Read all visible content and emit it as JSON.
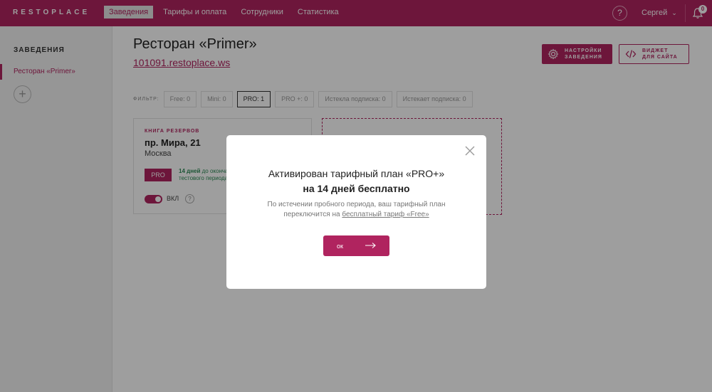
{
  "app": {
    "logo": "RESTOPLACE"
  },
  "topnav": {
    "items": [
      {
        "label": "Заведения",
        "active": true
      },
      {
        "label": "Тарифы и оплата",
        "active": false
      },
      {
        "label": "Сотрудники",
        "active": false
      },
      {
        "label": "Статистика",
        "active": false
      }
    ],
    "help": "?",
    "user": "Сергей",
    "notifications_count": "0"
  },
  "sidebar": {
    "title": "ЗАВЕДЕНИЯ",
    "items": [
      {
        "label": "Ресторан «Primer»"
      }
    ],
    "add": "+"
  },
  "main": {
    "title": "Ресторан «Primer»",
    "link": "101091.restoplace.ws",
    "settings_btn": [
      "НАСТРОЙКИ",
      "ЗАВЕДЕНИЯ"
    ],
    "widget_btn": [
      "ВИДЖЕТ",
      "ДЛЯ САЙТА"
    ],
    "filter_label": "ФИЛЬТР:",
    "filters": [
      {
        "label": "Free: 0",
        "active": false
      },
      {
        "label": "Mini: 0",
        "active": false
      },
      {
        "label": "PRO: 1",
        "active": true
      },
      {
        "label": "PRO +: 0",
        "active": false
      },
      {
        "label": "Истекла подписка: 0",
        "active": false
      },
      {
        "label": "Истекает подписка: 0",
        "active": false
      }
    ],
    "card": {
      "kicker": "КНИГА РЕЗЕРВОВ",
      "address": "пр. Мира, 21",
      "city": "Москва",
      "plan": "PRO",
      "trial_bold": "14 дней",
      "trial_line1": "до окончания",
      "trial_line2": "тестового периода",
      "toggle_label": "ВКЛ",
      "help": "?"
    }
  },
  "modal": {
    "title": "Активирован тарифный план «PRO+»",
    "subtitle": "на 14 дней бесплатно",
    "body_line1": "По истечении пробного периода, ваш тарифный план",
    "body_line2": "переключится на",
    "body_link": "бесплатный тариф «Free»",
    "ok": "ок"
  },
  "colors": {
    "brand": "#b0245f",
    "success": "#2e8b57"
  }
}
